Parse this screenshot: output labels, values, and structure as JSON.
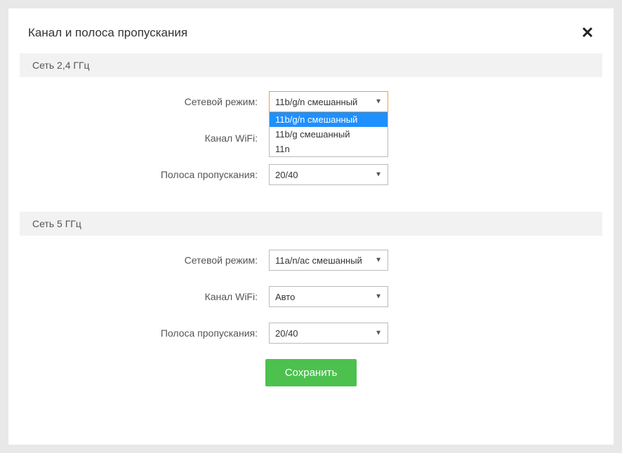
{
  "modal": {
    "title": "Канал и полоса пропускания",
    "close": "✕"
  },
  "band24": {
    "header": "Сеть 2,4 ГГц",
    "mode_label": "Сетевой режим:",
    "mode_value": "11b/g/n смешанный",
    "mode_options": {
      "opt0": "11b/g/n смешанный",
      "opt1": "11b/g смешанный",
      "opt2": "11n"
    },
    "channel_label": "Канал WiFi:",
    "bandwidth_label": "Полоса пропускания:",
    "bandwidth_value": "20/40"
  },
  "band5": {
    "header": "Сеть 5 ГГц",
    "mode_label": "Сетевой режим:",
    "mode_value": "11a/n/ac смешанный",
    "channel_label": "Канал WiFi:",
    "channel_value": "Авто",
    "bandwidth_label": "Полоса пропускания:",
    "bandwidth_value": "20/40"
  },
  "save_label": "Сохранить"
}
